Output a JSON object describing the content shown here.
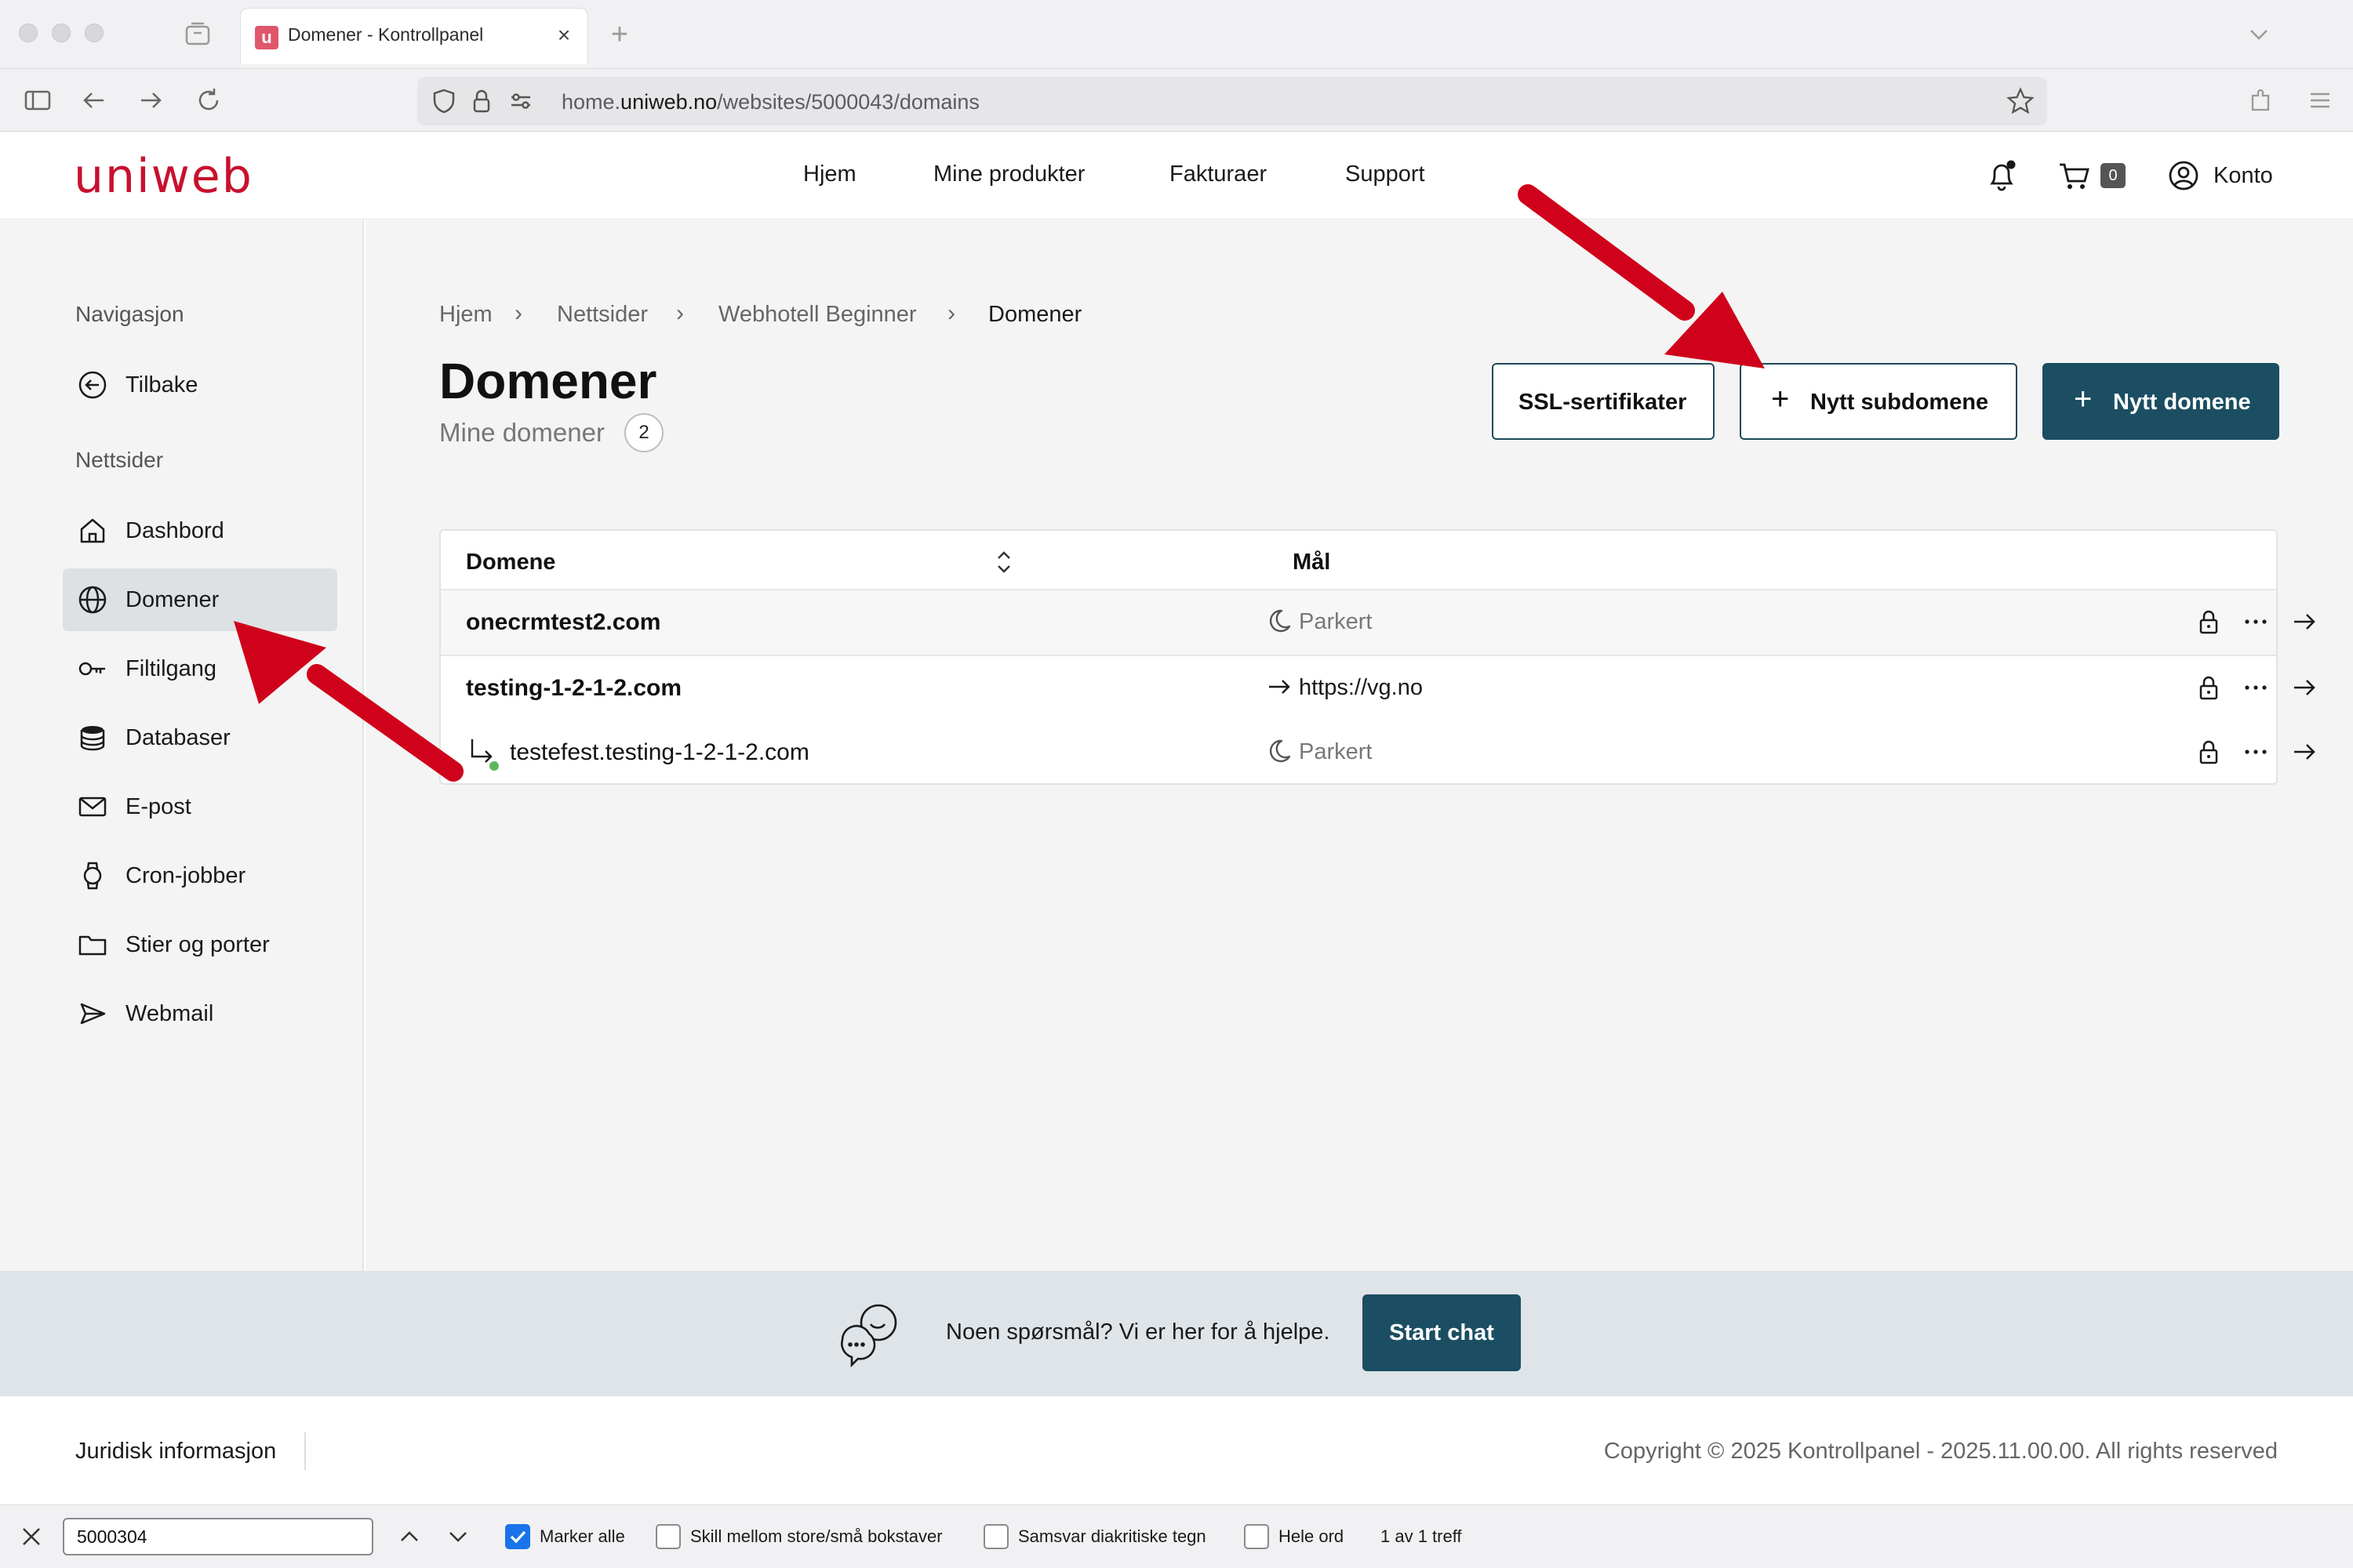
{
  "browser": {
    "tab_title": "Domener - Kontrollpanel",
    "tab_favicon_letter": "u",
    "tab_close": "×",
    "new_tab": "+",
    "url_prefix": "home.",
    "url_host": "uniweb.no",
    "url_path": "/websites/5000043/domains"
  },
  "header": {
    "logo": "uniweb",
    "nav": [
      "Hjem",
      "Mine produkter",
      "Fakturaer",
      "Support"
    ],
    "cart_count": "0",
    "account_label": "Konto"
  },
  "sidebar": {
    "heading_navigation": "Navigasjon",
    "back_label": "Tilbake",
    "heading_websites": "Nettsider",
    "items": [
      {
        "label": "Dashbord",
        "icon": "home-icon"
      },
      {
        "label": "Domener",
        "icon": "globe-icon",
        "active": true
      },
      {
        "label": "Filtilgang",
        "icon": "key-icon"
      },
      {
        "label": "Databaser",
        "icon": "database-icon"
      },
      {
        "label": "E-post",
        "icon": "mail-icon"
      },
      {
        "label": "Cron-jobber",
        "icon": "watch-icon"
      },
      {
        "label": "Stier og porter",
        "icon": "folder-icon"
      },
      {
        "label": "Webmail",
        "icon": "send-icon"
      }
    ]
  },
  "main": {
    "breadcrumbs": [
      "Hjem",
      "Nettsider",
      "Webhotell Beginner",
      "Domener"
    ],
    "breadcrumb_sep": "›",
    "title": "Domener",
    "subtitle": "Mine domener",
    "domain_count": "2",
    "buttons": {
      "ssl": "SSL-sertifikater",
      "new_subdomain": "Nytt subdomene",
      "new_domain": "Nytt domene",
      "plus": "+"
    },
    "table": {
      "columns": [
        "Domene",
        "Mål"
      ],
      "rows": [
        {
          "domain": "onecrmtest2.com",
          "target": "Parkert",
          "target_icon": "moon-icon",
          "subdomain": false
        },
        {
          "domain": "testing-1-2-1-2.com",
          "target": "https://vg.no",
          "target_icon": "arrow-right-icon",
          "subdomain": false
        },
        {
          "domain": "testefest.testing-1-2-1-2.com",
          "target": "Parkert",
          "target_icon": "moon-icon",
          "subdomain": true
        }
      ]
    }
  },
  "help": {
    "text": "Noen spørsmål? Vi er her for å hjelpe.",
    "chat_button": "Start chat"
  },
  "footer": {
    "legal": "Juridisk informasjon",
    "copyright": "Copyright © 2025 Kontrollpanel - 2025.11.00.00. All rights reserved"
  },
  "findbar": {
    "query": "5000304",
    "options": [
      {
        "label": "Marker alle",
        "checked": true
      },
      {
        "label": "Skill mellom store/små bokstaver",
        "checked": false
      },
      {
        "label": "Samsvar diakritiske tegn",
        "checked": false
      },
      {
        "label": "Hele ord",
        "checked": false
      }
    ],
    "result": "1 av 1 treff"
  },
  "colors": {
    "brand_red": "#c8102e",
    "primary_button": "#1b4e62",
    "annotation_arrow": "#d0021b"
  }
}
